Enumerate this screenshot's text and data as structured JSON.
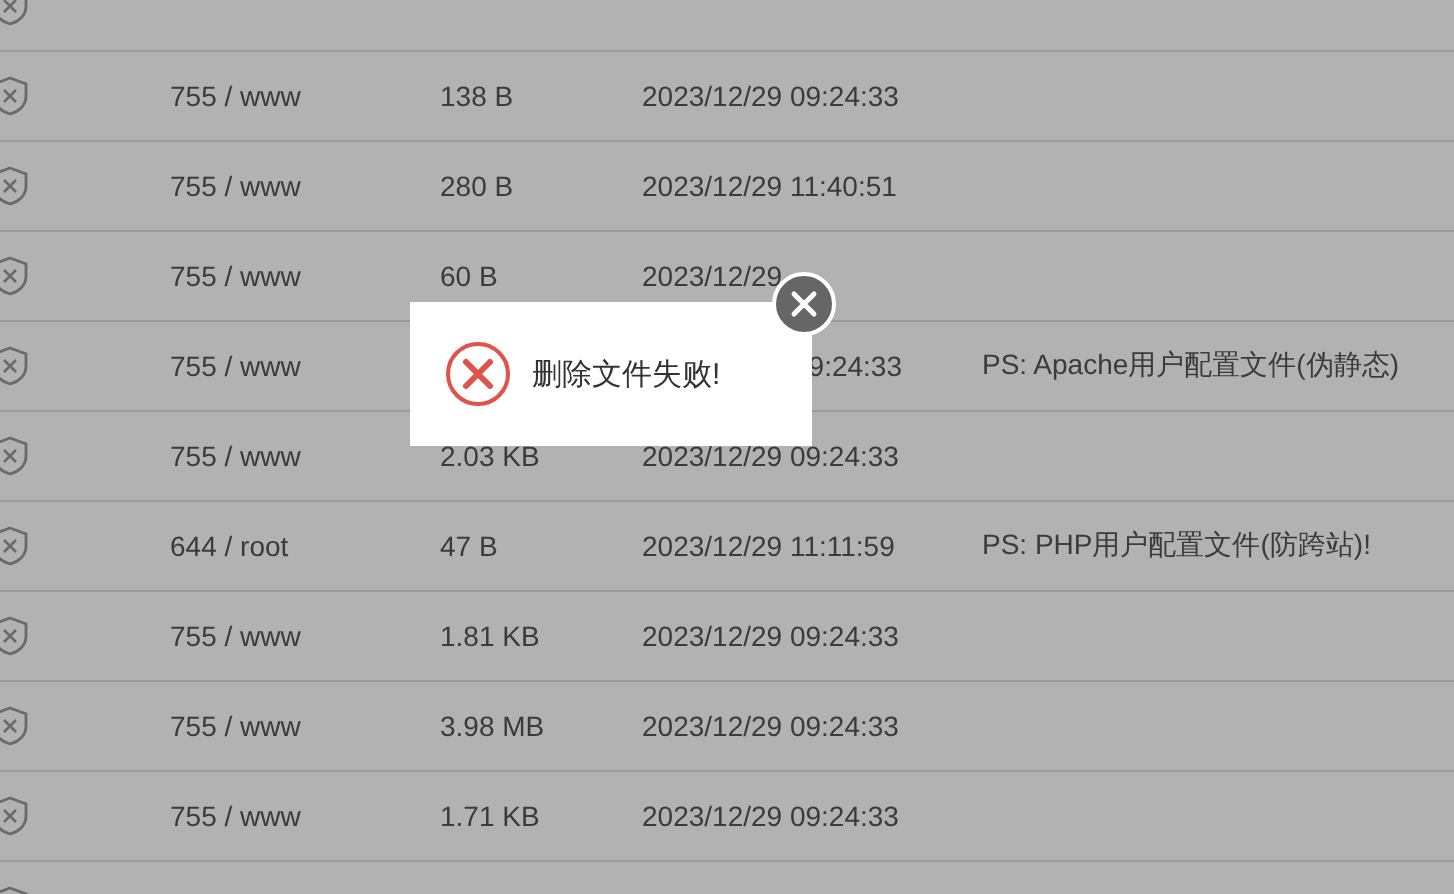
{
  "files": {
    "rows": [
      {
        "permission": "755 / www",
        "size": "138 B",
        "modified": "2023/12/29 09:24:33",
        "modified_start_covered": false
      },
      {
        "permission": "755 / www",
        "size": "280 B",
        "modified": "2023/12/29 11:40:51",
        "modified_start_covered": false
      },
      {
        "permission": "755 / www",
        "size": "60 B",
        "modified": "2023/12/29",
        "modified_start_covered": false
      },
      {
        "permission": "755 / www",
        "modified": "9:24:33",
        "modified_start_covered": true,
        "note": "PS: Apache用户配置文件(伪静态)"
      },
      {
        "permission": "755 / www",
        "size": "2.03 KB",
        "modified": "2023/12/29 09:24:33",
        "modified_start_covered": false
      },
      {
        "permission": "644 / root",
        "size": "47 B",
        "modified": "2023/12/29 11:11:59",
        "modified_start_covered": false,
        "note": "PS: PHP用户配置文件(防跨站)!"
      },
      {
        "permission": "755 / www",
        "size": "1.81 KB",
        "modified": "2023/12/29 09:24:33",
        "modified_start_covered": false
      },
      {
        "permission": "755 / www",
        "size": "3.98 MB",
        "modified": "2023/12/29 09:24:33",
        "modified_start_covered": false
      },
      {
        "permission": "755 / www",
        "size": "1.71 KB",
        "modified": "2023/12/29 09:24:33",
        "modified_start_covered": false
      }
    ]
  },
  "dialog": {
    "kind": "error",
    "message": "删除文件失败!"
  }
}
